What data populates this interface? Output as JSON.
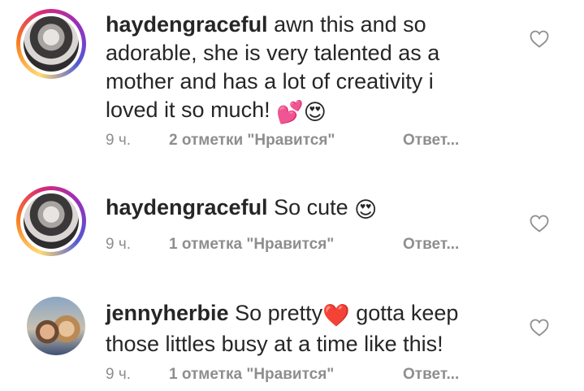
{
  "comments": [
    {
      "username": "haydengraceful",
      "text": "awn this and so adorable, she is very talented as a mother and has a lot of creativity i loved it so much!",
      "emoji": "💕😍",
      "time": "9 ч.",
      "likes": "2 отметки \"Нравится\"",
      "reply": "Ответ..."
    },
    {
      "username": "haydengraceful",
      "text": "So cute",
      "emoji": "😍",
      "time": "9 ч.",
      "likes": "1 отметка \"Нравится\"",
      "reply": "Ответ..."
    },
    {
      "username": "jennyherbie",
      "text_before": "So pretty",
      "inline_emoji": "❤️",
      "text_after": "gotta keep those littles busy at a time like this!",
      "time": "9 ч.",
      "likes": "1 отметка \"Нравится\"",
      "reply": "Ответ..."
    }
  ],
  "icons": {
    "like": "heart-outline-icon"
  },
  "colors": {
    "text": "#262626",
    "meta": "#8e8e8e",
    "heart_red": "#e0245e"
  }
}
